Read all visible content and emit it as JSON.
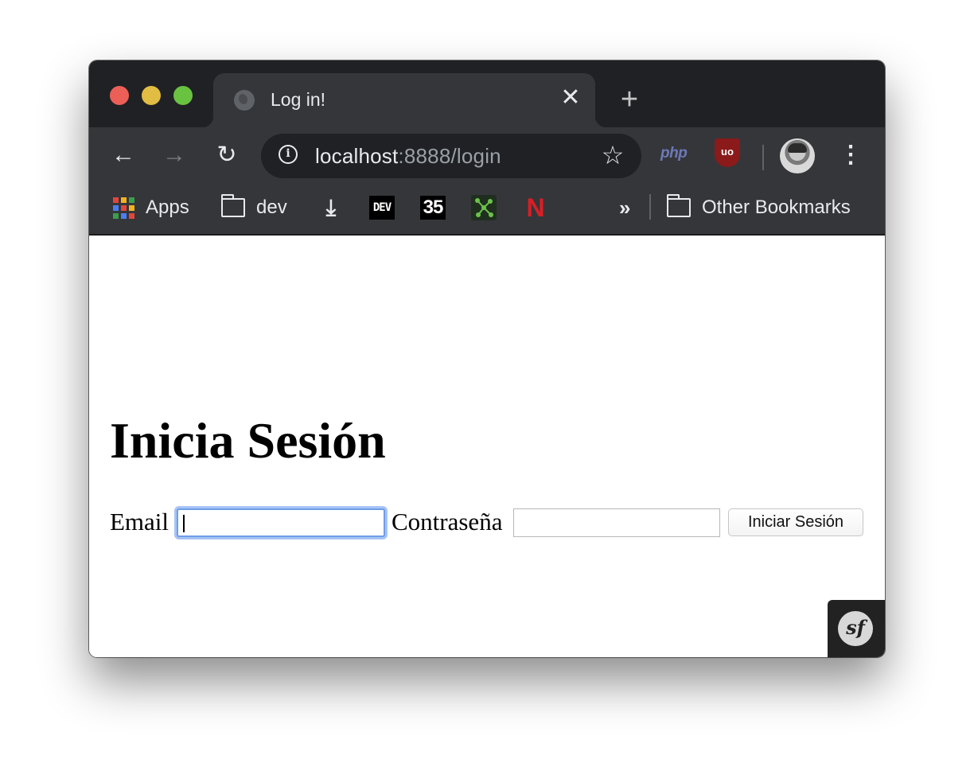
{
  "tab": {
    "title": "Log in!",
    "close_glyph": "✕",
    "new_tab_glyph": "+"
  },
  "toolbar": {
    "back_glyph": "←",
    "forward_glyph": "→",
    "reload_glyph": "↻",
    "url_host": "localhost",
    "url_path": ":8888/login",
    "info_glyph": "i",
    "star_glyph": "☆",
    "extensions": {
      "php_label": "php",
      "ublock_label": "uo"
    },
    "menu_glyph": "⋮"
  },
  "bookmarks": {
    "apps_label": "Apps",
    "dev_folder_label": "dev",
    "download_glyph": "⤓",
    "dev_icon_text": "DEV",
    "num_icon_text": "35",
    "netflix_icon_text": "N",
    "overflow_glyph": "»",
    "other_label": "Other Bookmarks",
    "apps_colors": [
      "#e2463b",
      "#f2b321",
      "#3b9e4c",
      "#4a7ef1",
      "#e2463b",
      "#f2b321",
      "#3b9e4c",
      "#4a7ef1",
      "#e2463b"
    ]
  },
  "page": {
    "heading": "Inicia Sesión",
    "email_label": "Email",
    "email_value": "",
    "password_label": "Contraseña",
    "password_value": "",
    "submit_label": "Iniciar Sesión",
    "symfony_logo_text": "sf"
  },
  "colors": {
    "titlebar_bg": "#202124",
    "toolbar_bg": "#35363a",
    "focus_ring": "#6f9ee8",
    "traffic_red": "#ec5f57",
    "traffic_yellow": "#e2bd43",
    "traffic_green": "#6ac241"
  }
}
